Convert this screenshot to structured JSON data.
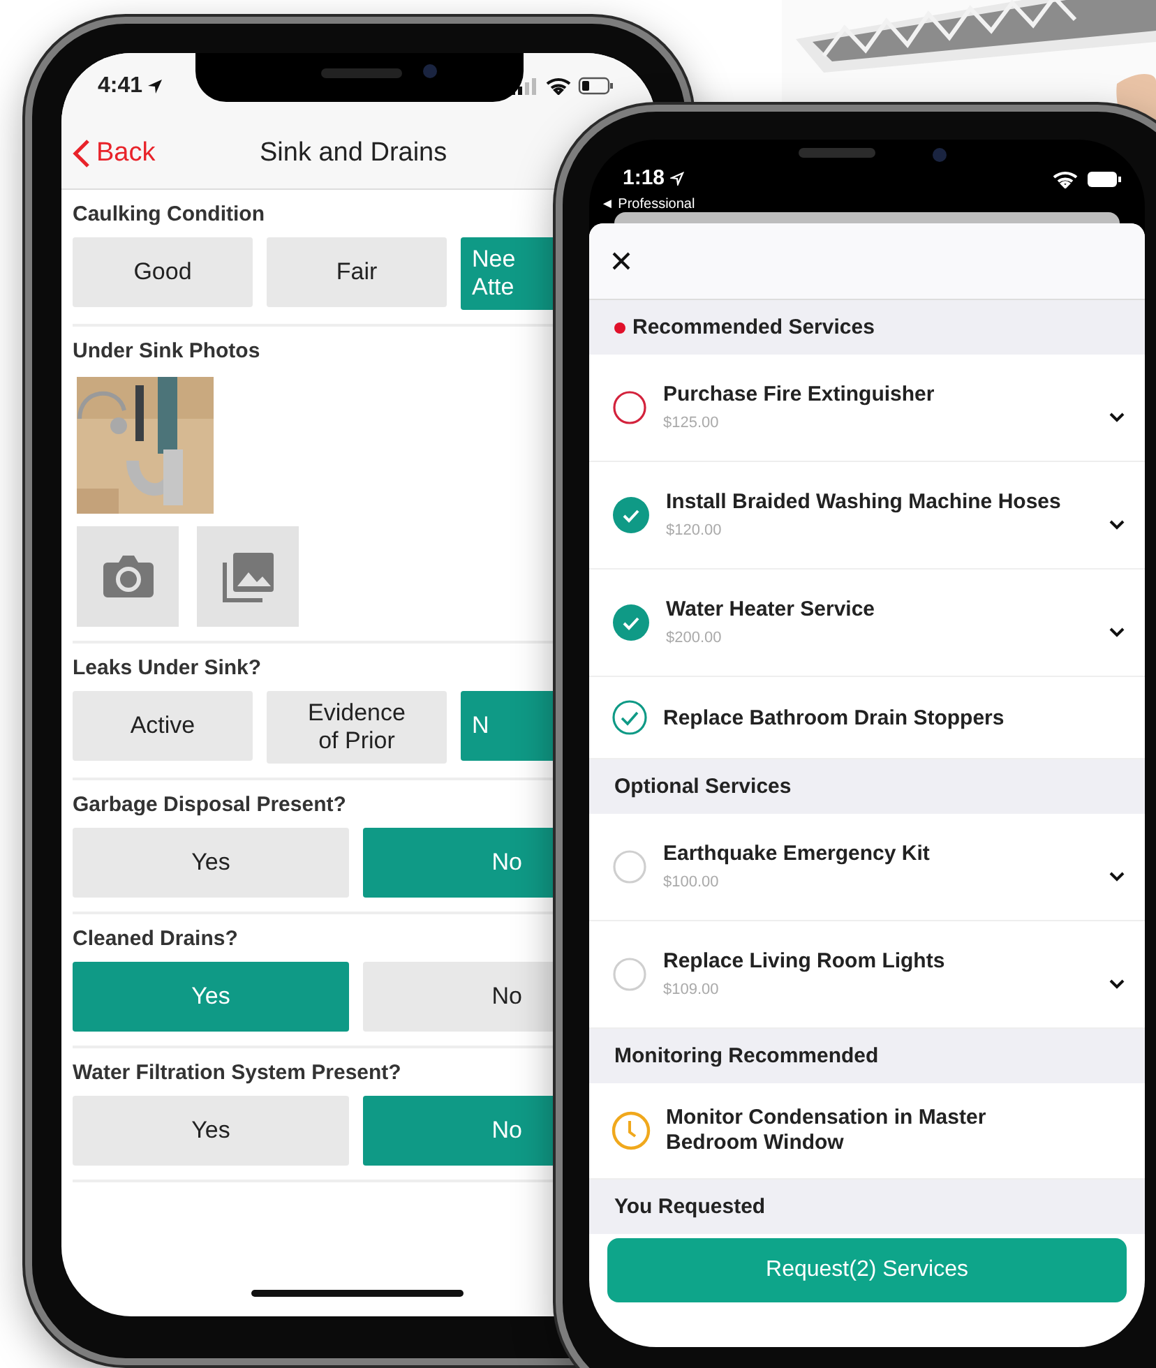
{
  "left_phone": {
    "status_bar": {
      "time": "4:41"
    },
    "nav": {
      "back": "Back",
      "title": "Sink and Drains"
    },
    "sections": [
      {
        "kind": "choice",
        "label": "Caulking Condition",
        "options": [
          {
            "label": "Good",
            "selected": false
          },
          {
            "label": "Fair",
            "selected": false
          },
          {
            "label": "Nee Atte",
            "selected": true
          }
        ]
      },
      {
        "kind": "photos",
        "label": "Under Sink Photos"
      },
      {
        "kind": "choice",
        "label": "Leaks Under Sink?",
        "options": [
          {
            "label": "Active",
            "selected": false
          },
          {
            "label": "Evidence of Prior",
            "selected": false
          },
          {
            "label": "N",
            "selected": true
          }
        ]
      },
      {
        "kind": "choice",
        "label": "Garbage Disposal Present?",
        "options": [
          {
            "label": "Yes",
            "selected": false
          },
          {
            "label": "No",
            "selected": true
          }
        ]
      },
      {
        "kind": "choice",
        "label": "Cleaned Drains?",
        "options": [
          {
            "label": "Yes",
            "selected": true
          },
          {
            "label": "No",
            "selected": false
          }
        ]
      },
      {
        "kind": "choice",
        "label": "Water Filtration System Present?",
        "options": [
          {
            "label": "Yes",
            "selected": false
          },
          {
            "label": "No",
            "selected": true
          }
        ]
      }
    ]
  },
  "right_phone": {
    "status_bar": {
      "time": "1:18",
      "back_app": "◄ Professional"
    },
    "sections": [
      {
        "title": "Recommended Services",
        "flagged": true,
        "items": [
          {
            "kind": "service",
            "title": "Purchase Fire Extinguisher",
            "price": "$125.00",
            "checked": false,
            "required": true,
            "expandable": true
          },
          {
            "kind": "service",
            "title": "Install Braided Washing Machine Hoses",
            "price": "$120.00",
            "checked": true,
            "required": true,
            "expandable": true
          },
          {
            "kind": "service",
            "title": "Water Heater Service",
            "price": "$200.00",
            "checked": true,
            "required": true,
            "expandable": true
          },
          {
            "kind": "service",
            "title": "Replace Bathroom Drain Stoppers",
            "checked": true,
            "required": false,
            "expandable": false
          }
        ]
      },
      {
        "title": "Optional Services",
        "flagged": false,
        "items": [
          {
            "kind": "service",
            "title": "Earthquake Emergency Kit",
            "price": "$100.00",
            "checked": false,
            "required": false,
            "expandable": true
          },
          {
            "kind": "service",
            "title": "Replace Living Room Lights",
            "price": "$109.00",
            "checked": false,
            "required": false,
            "expandable": true
          }
        ]
      },
      {
        "title": "Monitoring Recommended",
        "flagged": false,
        "items": [
          {
            "kind": "monitor",
            "title": "Monitor Condensation in Master Bedroom Window"
          }
        ]
      },
      {
        "title": "You Requested",
        "flagged": false
      }
    ],
    "button": "Request(2) Services"
  }
}
